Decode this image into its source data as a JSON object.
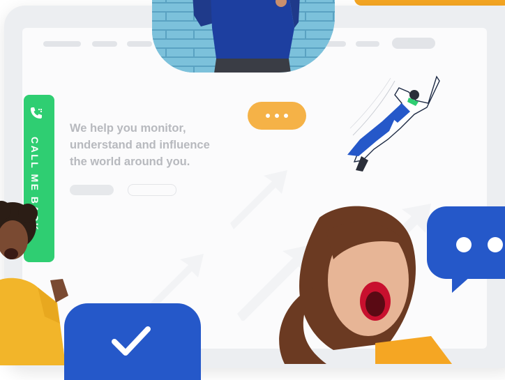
{
  "hero": {
    "line1": "We help you monitor,",
    "line2": "understand and influence",
    "line3": "the world around you."
  },
  "callback_tab": {
    "label": "CALL ME BACK",
    "icon": "phone-icon"
  },
  "chat_bubbles": {
    "orange": {
      "icon": "ellipsis-icon",
      "color": "#f5b247"
    },
    "blue": {
      "icon": "ellipsis-icon",
      "color": "#2558c9"
    }
  },
  "check_card": {
    "icon": "checkmark-icon",
    "color": "#2558c9"
  },
  "accent": {
    "green": "#2fce72",
    "orange": "#f5a623",
    "blue": "#2558c9"
  }
}
